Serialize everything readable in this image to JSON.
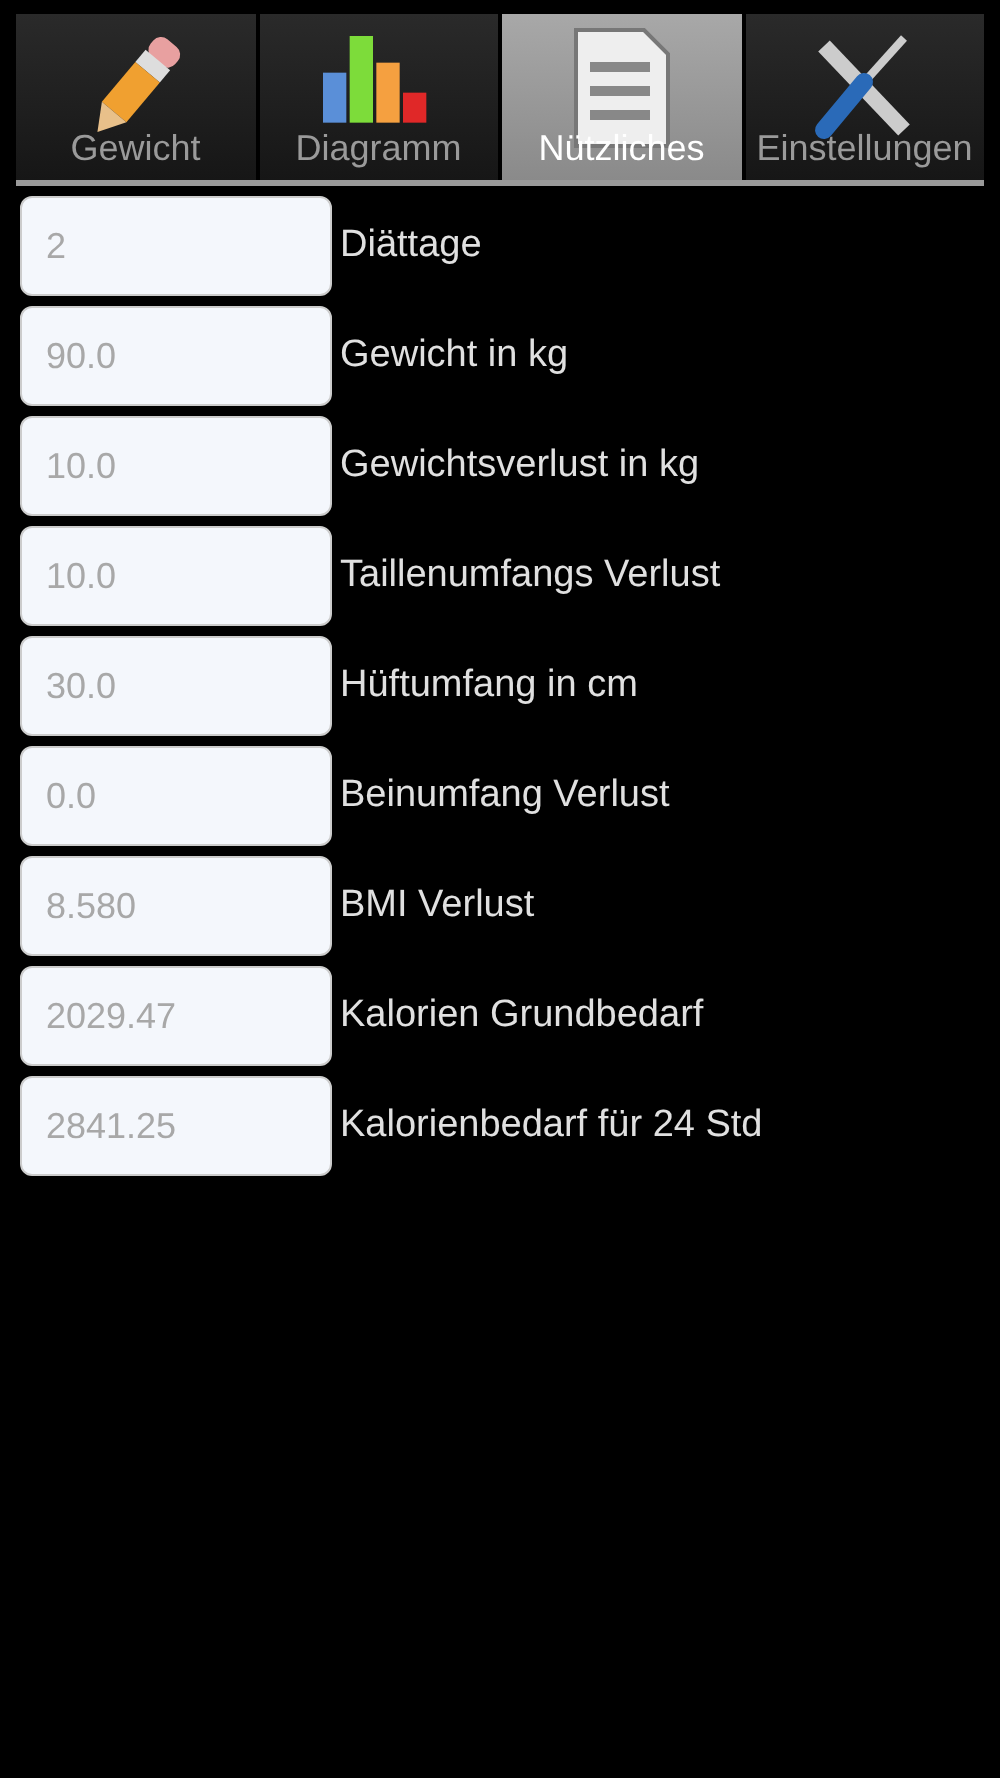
{
  "tabs": [
    {
      "label": "Gewicht",
      "selected": false
    },
    {
      "label": "Diagramm",
      "selected": false
    },
    {
      "label": "Nützliches",
      "selected": true
    },
    {
      "label": "Einstellungen",
      "selected": false
    }
  ],
  "fields": [
    {
      "value": "2",
      "label": "Diättage"
    },
    {
      "value": "90.0",
      "label": "Gewicht in kg"
    },
    {
      "value": "10.0",
      "label": "Gewichtsverlust in kg"
    },
    {
      "value": "10.0",
      "label": "Taillenumfangs Verlust"
    },
    {
      "value": "30.0",
      "label": "Hüftumfang in cm"
    },
    {
      "value": "0.0",
      "label": "Beinumfang Verlust"
    },
    {
      "value": "8.580",
      "label": "BMI Verlust"
    },
    {
      "value": "2029.47",
      "label": "Kalorien Grundbedarf"
    },
    {
      "value": "2841.25",
      "label": "Kalorienbedarf für 24 Std"
    }
  ]
}
